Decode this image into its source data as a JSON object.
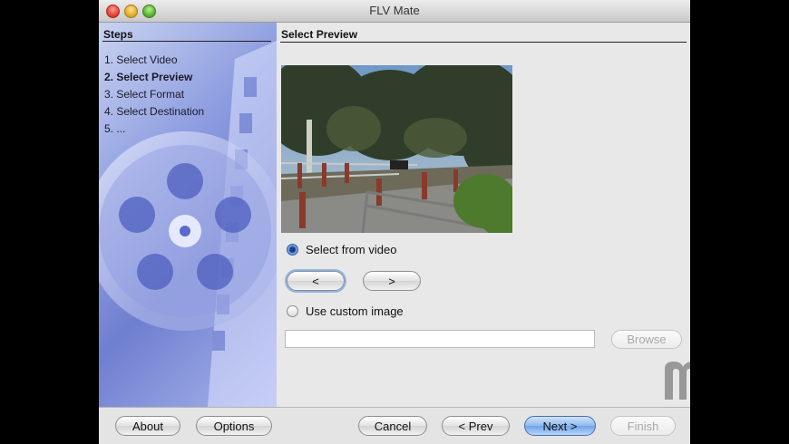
{
  "window": {
    "title": "FLV Mate"
  },
  "sidebar": {
    "heading": "Steps",
    "steps": [
      "1. Select Video",
      "2. Select Preview",
      "3. Select Format",
      "4. Select Destination",
      "5. ..."
    ],
    "active_step": 1
  },
  "content": {
    "heading": "Select Preview",
    "option_video": "Select from video",
    "option_custom": "Use custom image",
    "prev_frame_label": "<",
    "next_frame_label": ">",
    "custom_image_path": "",
    "browse_label": "Browse"
  },
  "footer": {
    "about": "About",
    "options": "Options",
    "cancel": "Cancel",
    "prev": "< Prev",
    "next": "Next >",
    "finish": "Finish"
  },
  "colors": {
    "sidebar_accent": "#7f8fd8",
    "default_button": "#6fa2e7"
  }
}
